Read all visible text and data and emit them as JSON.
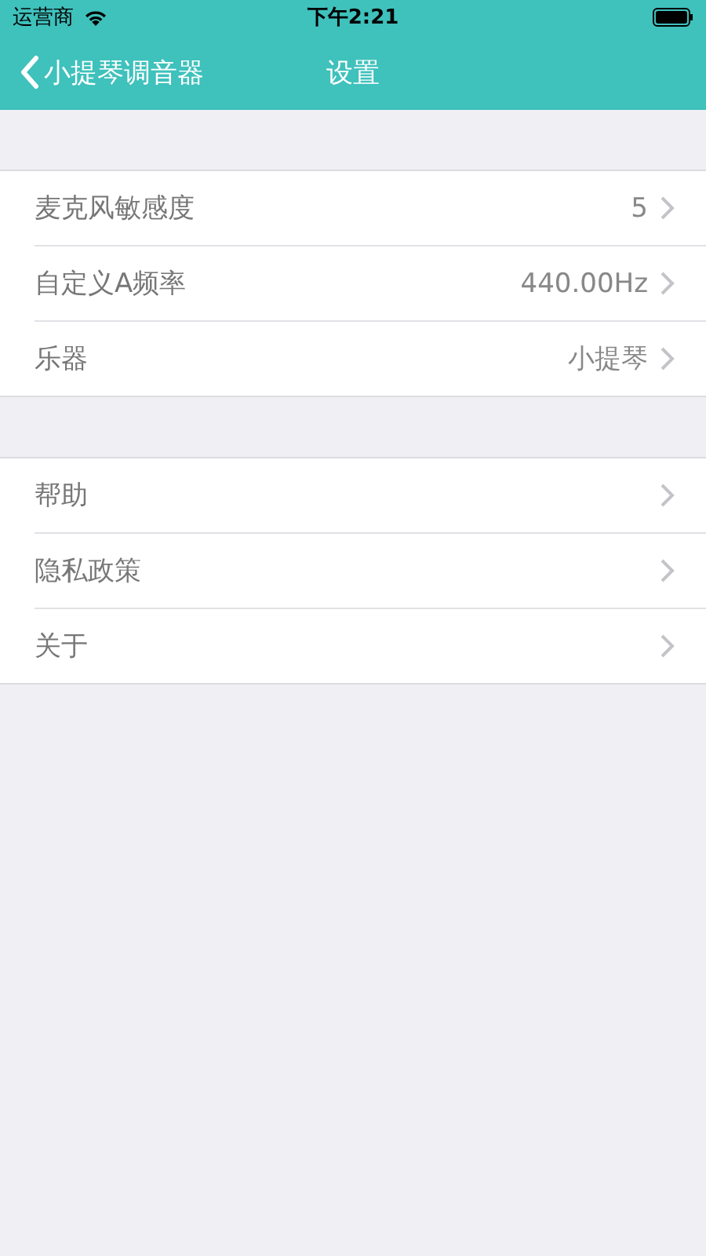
{
  "status_bar": {
    "carrier": "运营商",
    "time": "下午2:21"
  },
  "nav": {
    "back": "小提琴调音器",
    "title": "设置"
  },
  "sections": [
    {
      "rows": [
        {
          "label": "麦克风敏感度",
          "value": "5"
        },
        {
          "label": "自定义A频率",
          "value": "440.00Hz"
        },
        {
          "label": "乐器",
          "value": "小提琴"
        }
      ]
    },
    {
      "rows": [
        {
          "label": "帮助"
        },
        {
          "label": "隐私政策"
        },
        {
          "label": "关于"
        }
      ]
    }
  ]
}
